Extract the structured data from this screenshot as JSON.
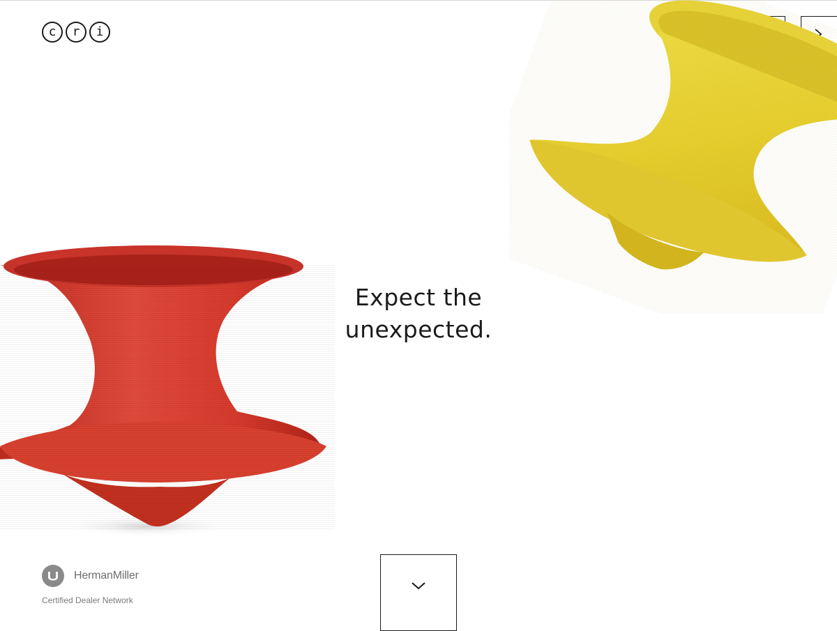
{
  "logo": {
    "letters": [
      "c",
      "r",
      "i"
    ]
  },
  "header": {
    "menu_icon": "hamburger-icon",
    "next_icon": "chevron-right-icon"
  },
  "hero": {
    "headline_line1": "Expect the",
    "headline_line2": "unexpected."
  },
  "dealer": {
    "brand": "HermanMiller",
    "network": "Certified Dealer Network",
    "logo_icon": "herman-miller-logo"
  },
  "scroll": {
    "icon": "chevron-down-icon"
  },
  "colors": {
    "red_chair": "#d33b2c",
    "yellow_chair": "#e9d63a",
    "text": "#1a1a1a"
  }
}
